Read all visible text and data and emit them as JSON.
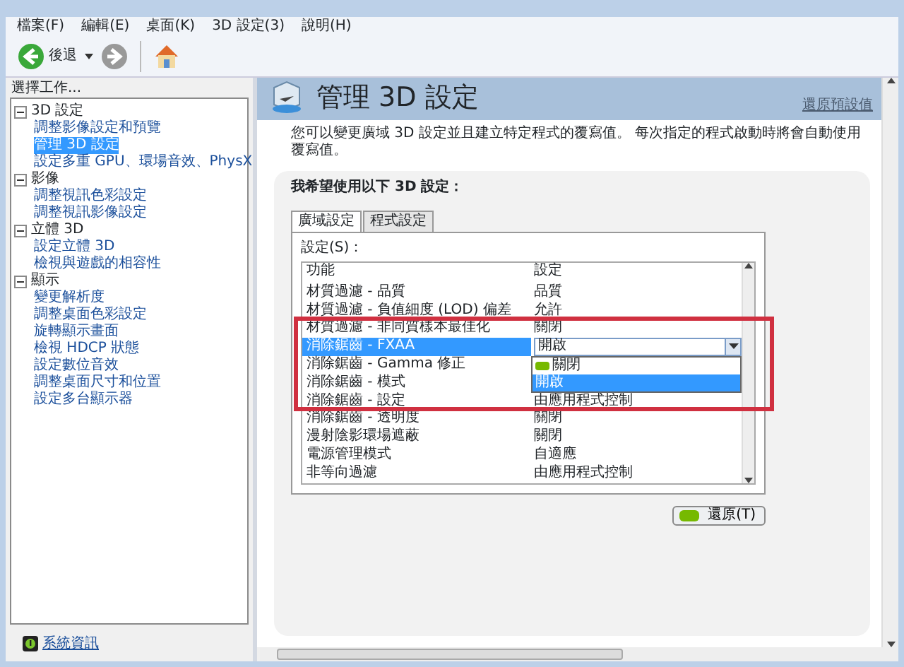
{
  "menu": [
    "檔案(F)",
    "編輯(E)",
    "桌面(K)",
    "3D 設定(3)",
    "說明(H)"
  ],
  "toolbar": {
    "back_label": "後退"
  },
  "sidebar": {
    "title": "選擇工作...",
    "tree": [
      {
        "label": "3D 設定",
        "expanded": true,
        "children": [
          {
            "label": "調整影像設定和預覽",
            "selected": false
          },
          {
            "label": "管理 3D 設定",
            "selected": true
          },
          {
            "label": "設定多重 GPU、環場音效、PhysX",
            "selected": false
          }
        ]
      },
      {
        "label": "影像",
        "expanded": true,
        "children": [
          {
            "label": "調整視訊色彩設定",
            "selected": false
          },
          {
            "label": "調整視訊影像設定",
            "selected": false
          }
        ]
      },
      {
        "label": "立體 3D",
        "expanded": true,
        "children": [
          {
            "label": "設定立體 3D",
            "selected": false
          },
          {
            "label": "檢視與遊戲的相容性",
            "selected": false
          }
        ]
      },
      {
        "label": "顯示",
        "expanded": true,
        "children": [
          {
            "label": "變更解析度",
            "selected": false
          },
          {
            "label": "調整桌面色彩設定",
            "selected": false
          },
          {
            "label": "旋轉顯示畫面",
            "selected": false
          },
          {
            "label": "檢視 HDCP 狀態",
            "selected": false
          },
          {
            "label": "設定數位音效",
            "selected": false
          },
          {
            "label": "調整桌面尺寸和位置",
            "selected": false
          },
          {
            "label": "設定多台顯示器",
            "selected": false
          }
        ]
      }
    ],
    "footer_link": "系統資訊"
  },
  "page": {
    "title": "管理 3D 設定",
    "restore_defaults": "還原預設值",
    "description": "您可以變更廣域 3D 設定並且建立特定程式的覆寫值。 每次指定的程式啟動時將會自動使用覆寫值。",
    "section_title": "我希望使用以下 3D 設定：",
    "tabs": [
      {
        "label": "廣域設定",
        "selected": true
      },
      {
        "label": "程式設定",
        "selected": false
      }
    ],
    "settings_label": "設定(S)：",
    "table": {
      "columns": [
        "功能",
        "設定"
      ],
      "rows": [
        {
          "feature": "材質過濾 - 品質",
          "setting": "品質",
          "selected": false
        },
        {
          "feature": "材質過濾 - 負值細度 (LOD) 偏差",
          "setting": "允許",
          "selected": false
        },
        {
          "feature": "材質過濾 - 非同質樣本最佳化",
          "setting": "關閉",
          "selected": false
        },
        {
          "feature": "消除鋸齒 - FXAA",
          "setting": "開啟",
          "selected": true
        },
        {
          "feature": "消除鋸齒 - Gamma 修正",
          "selected": false
        },
        {
          "feature": "消除鋸齒 - 模式",
          "selected": false
        },
        {
          "feature": "消除鋸齒 - 設定",
          "setting": "由應用程式控制",
          "selected": false
        },
        {
          "feature": "消除鋸齒 - 透明度",
          "setting": "關閉",
          "selected": false
        },
        {
          "feature": "漫射陰影環場遮蔽",
          "setting": "關閉",
          "selected": false
        },
        {
          "feature": "電源管理模式",
          "setting": "自適應",
          "selected": false
        },
        {
          "feature": "非等向過濾",
          "setting": "由應用程式控制",
          "selected": false
        }
      ]
    },
    "dropdown": {
      "options": [
        {
          "label": "關閉",
          "selected": false
        },
        {
          "label": "開啟",
          "selected": true
        }
      ]
    },
    "restore_button": "還原(T)"
  }
}
